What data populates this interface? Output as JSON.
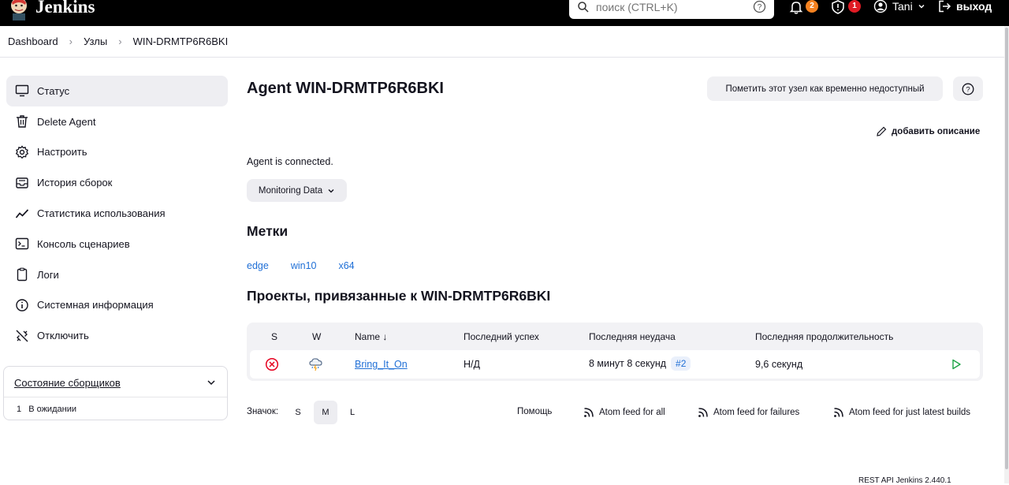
{
  "header": {
    "brand": "Jenkins",
    "search_placeholder": "поиск (CTRL+K)",
    "notifications_count": "2",
    "security_count": "1",
    "user_name": "Tani",
    "logout_label": "выход",
    "colors": {
      "bar": "#000000",
      "notif_badge": "#f58220",
      "security_badge": "#e01b24"
    }
  },
  "breadcrumb": {
    "items": [
      "Dashboard",
      "Узлы",
      "WIN-DRMTP6R6BKI"
    ]
  },
  "sidebar": {
    "items": [
      {
        "label": "Статус",
        "icon": "monitor-icon",
        "active": true
      },
      {
        "label": "Delete Agent",
        "icon": "trash-icon"
      },
      {
        "label": "Настроить",
        "icon": "gear-icon"
      },
      {
        "label": "История сборок",
        "icon": "inbox-icon"
      },
      {
        "label": "Статистика использования",
        "icon": "trend-icon"
      },
      {
        "label": "Консоль сценариев",
        "icon": "terminal-icon"
      },
      {
        "label": "Логи",
        "icon": "clipboard-icon"
      },
      {
        "label": "Системная информация",
        "icon": "info-icon"
      },
      {
        "label": "Отключить",
        "icon": "disconnect-icon"
      }
    ],
    "executors": {
      "title": "Состояние сборщиков",
      "rows": [
        {
          "num": "1",
          "status": "В ожидании"
        }
      ]
    }
  },
  "main": {
    "title": "Agent WIN-DRMTP6R6BKI",
    "mark_offline_button": "Пометить этот узел как временно недоступный",
    "add_description": "добавить описание",
    "status_text": "Agent is connected.",
    "monitoring_button": "Monitoring Data",
    "labels_heading": "Метки",
    "labels": [
      "edge",
      "win10",
      "x64"
    ],
    "projects_heading": "Проекты, привязанные к WIN-DRMTP6R6BKI",
    "table": {
      "headers": {
        "s": "S",
        "w": "W",
        "name": "Name ↓",
        "last_success": "Последний успех",
        "last_failure": "Последняя неудача",
        "last_duration": "Последняя продолжительность"
      },
      "rows": [
        {
          "status_icon": "failed-icon",
          "weather_icon": "storm-icon",
          "name": "Bring_It_On",
          "last_success": "Н/Д",
          "last_failure": "8 минут 8 секунд",
          "failure_build": "#2",
          "last_duration": "9,6 секунд",
          "action_icon": "play-icon"
        }
      ]
    },
    "icon_size": {
      "label": "Значок:",
      "options": [
        "S",
        "M",
        "L"
      ],
      "selected": "M"
    },
    "footer_links": {
      "help": "Помощь",
      "atom_all": "Atom feed for all",
      "atom_failures": "Atom feed for failures",
      "atom_latest": "Atom feed for just latest builds"
    },
    "rest_api": "REST API     Jenkins 2.440.1"
  }
}
